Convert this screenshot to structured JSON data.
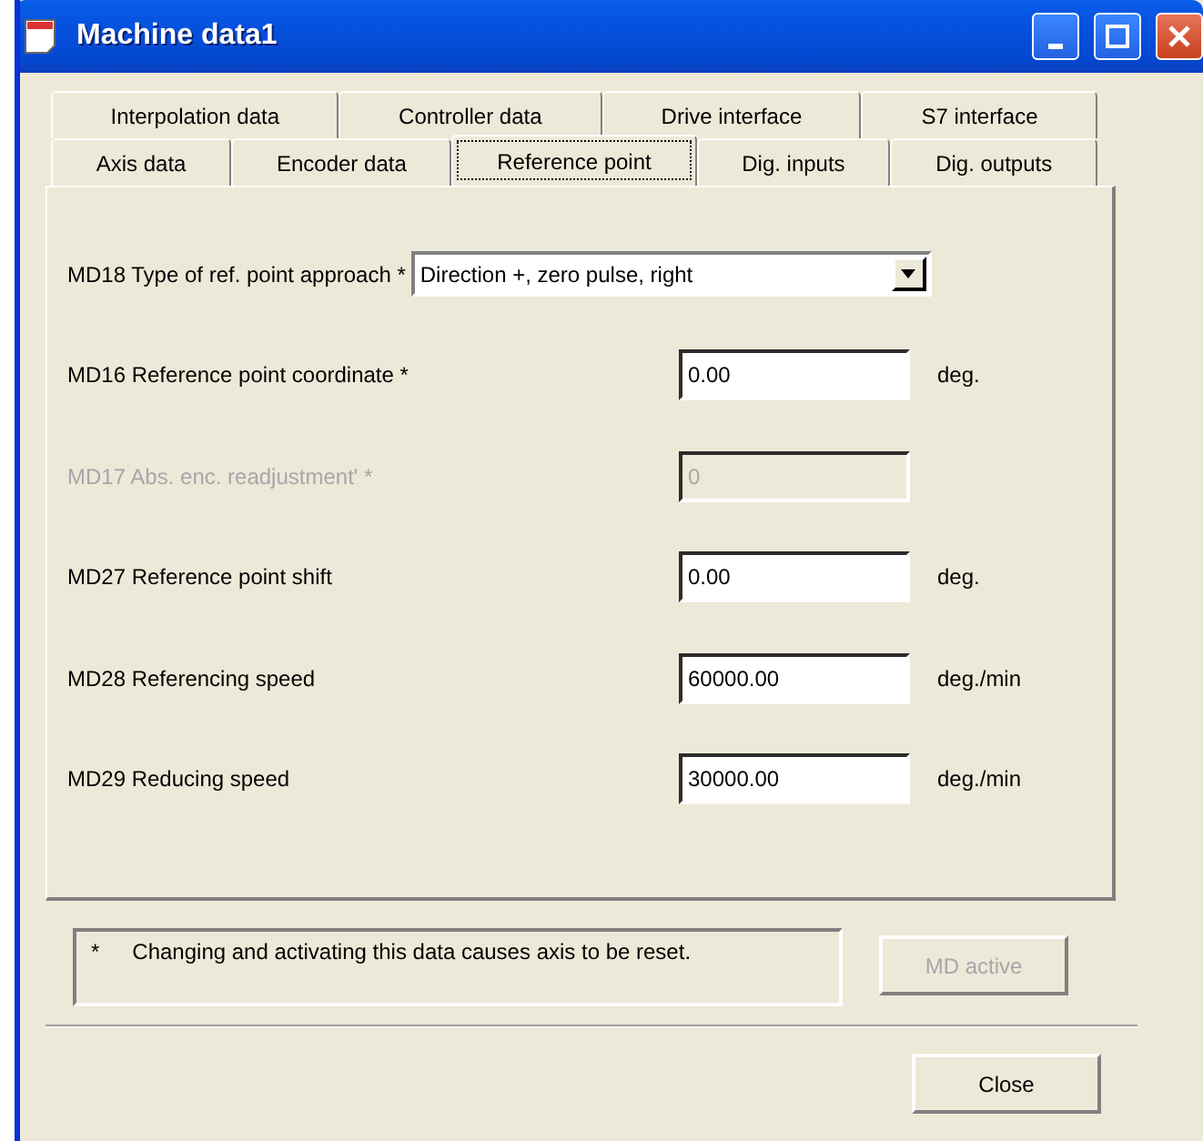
{
  "window": {
    "title": "Machine data1"
  },
  "tab_rows": [
    [
      {
        "label": "Interpolation data",
        "selected": false
      },
      {
        "label": "Controller data",
        "selected": false
      },
      {
        "label": "Drive interface",
        "selected": false
      },
      {
        "label": "S7 interface",
        "selected": false
      }
    ],
    [
      {
        "label": "Axis data",
        "selected": false
      },
      {
        "label": "Encoder data",
        "selected": false
      },
      {
        "label": "Reference point",
        "selected": true
      },
      {
        "label": "Dig. inputs",
        "selected": false
      },
      {
        "label": "Dig. outputs",
        "selected": false
      }
    ]
  ],
  "fields": [
    {
      "kind": "combo",
      "label": "MD18 Type of ref. point approach *",
      "value": "Direction +, zero pulse, right",
      "disabled": false
    },
    {
      "kind": "text",
      "label": "MD16 Reference point coordinate *",
      "value": "0.00",
      "unit": "deg.",
      "disabled": false
    },
    {
      "kind": "text",
      "label": "MD17 Abs. enc. readjustment' *",
      "value": "0",
      "disabled": true
    },
    {
      "kind": "text",
      "label": "MD27 Reference point shift",
      "value": "0.00",
      "unit": "deg.",
      "disabled": false
    },
    {
      "kind": "text",
      "label": "MD28 Referencing speed",
      "value": "60000.00",
      "unit": "deg./min",
      "disabled": false
    },
    {
      "kind": "text",
      "label": "MD29 Reducing speed",
      "value": "30000.00",
      "unit": "deg./min",
      "disabled": false
    }
  ],
  "note": {
    "marker": "*",
    "text": "Changing and activating this data causes axis to be reset."
  },
  "md_active_button": {
    "label": "MD active",
    "disabled": true
  },
  "close_button": {
    "label": "Close",
    "disabled": false
  }
}
